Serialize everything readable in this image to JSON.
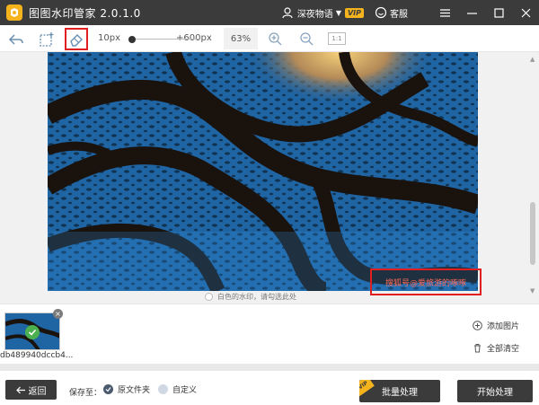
{
  "app": {
    "title": "图图水印管家  2.0.1.0",
    "username": "深夜物语",
    "vip_badge": "VIP",
    "customer_service": "客服"
  },
  "toolbar": {
    "brush_min": "10px",
    "brush_max": "+600px",
    "brush_level": 0.05,
    "zoom": "63%",
    "ratio_label": "1:1",
    "icons": [
      "back-icon",
      "rect-select-icon",
      "eraser-icon",
      "zoom-in-icon",
      "zoom-out-icon"
    ]
  },
  "canvas": {
    "watermark_text": "搜狐号@爱旅游的啄啄",
    "white_watermark_option": "白色的水印，请勾选此处"
  },
  "thumbnails": [
    {
      "name": "db489940dccb4..."
    }
  ],
  "side_actions": {
    "add_image": "添加图片",
    "clear_all": "全部清空"
  },
  "bottom": {
    "back_label": "返回",
    "save_to": "保存至：",
    "option_original": "原文件夹",
    "option_custom": "自定义",
    "selected_option": "原文件夹",
    "batch_label": "批量处理",
    "batch_badge": "VIP",
    "start_label": "开始处理"
  },
  "colors": {
    "titlebar": "#3b3b3b",
    "accent_yellow": "#f5b41d",
    "highlight_red": "#e02020",
    "photo_water": "#1c5e9a"
  }
}
